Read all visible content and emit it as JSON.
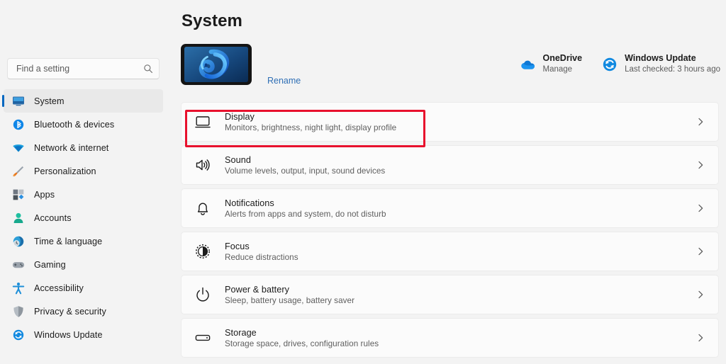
{
  "window": {
    "page_title": "System",
    "accent_color": "#0067c0",
    "background_color": "#f3f3f3",
    "card_color": "#fbfbfb",
    "annotation_color": "#e8112d"
  },
  "search": {
    "placeholder": "Find a setting",
    "value": "",
    "icon": "search-icon"
  },
  "sidebar": {
    "items": [
      {
        "label": "System",
        "icon": "monitor-icon",
        "selected": true
      },
      {
        "label": "Bluetooth & devices",
        "icon": "bluetooth-icon",
        "selected": false
      },
      {
        "label": "Network & internet",
        "icon": "wifi-icon",
        "selected": false
      },
      {
        "label": "Personalization",
        "icon": "paintbrush-icon",
        "selected": false
      },
      {
        "label": "Apps",
        "icon": "apps-grid-icon",
        "selected": false
      },
      {
        "label": "Accounts",
        "icon": "person-icon",
        "selected": false
      },
      {
        "label": "Time & language",
        "icon": "clock-globe-icon",
        "selected": false
      },
      {
        "label": "Gaming",
        "icon": "gamepad-icon",
        "selected": false
      },
      {
        "label": "Accessibility",
        "icon": "accessibility-icon",
        "selected": false
      },
      {
        "label": "Privacy & security",
        "icon": "shield-icon",
        "selected": false
      },
      {
        "label": "Windows Update",
        "icon": "refresh-icon",
        "selected": false
      }
    ]
  },
  "device": {
    "rename_label": "Rename",
    "thumbnail_icon": "device-bloom-thumbnail"
  },
  "quick_cards": [
    {
      "title": "OneDrive",
      "subtitle": "Manage",
      "icon": "onedrive-cloud-icon",
      "color": "#0f78d4"
    },
    {
      "title": "Windows Update",
      "subtitle": "Last checked: 3 hours ago",
      "icon": "refresh-icon",
      "color": "#0f78d4"
    }
  ],
  "settings_rows": [
    {
      "title": "Display",
      "subtitle": "Monitors, brightness, night light, display profile",
      "icon": "monitor-outline-icon",
      "highlighted": true
    },
    {
      "title": "Sound",
      "subtitle": "Volume levels, output, input, sound devices",
      "icon": "speaker-icon",
      "highlighted": false
    },
    {
      "title": "Notifications",
      "subtitle": "Alerts from apps and system, do not disturb",
      "icon": "bell-icon",
      "highlighted": false
    },
    {
      "title": "Focus",
      "subtitle": "Reduce distractions",
      "icon": "focus-icon",
      "highlighted": false
    },
    {
      "title": "Power & battery",
      "subtitle": "Sleep, battery usage, battery saver",
      "icon": "power-icon",
      "highlighted": false
    },
    {
      "title": "Storage",
      "subtitle": "Storage space, drives, configuration rules",
      "icon": "storage-drive-icon",
      "highlighted": false
    }
  ]
}
